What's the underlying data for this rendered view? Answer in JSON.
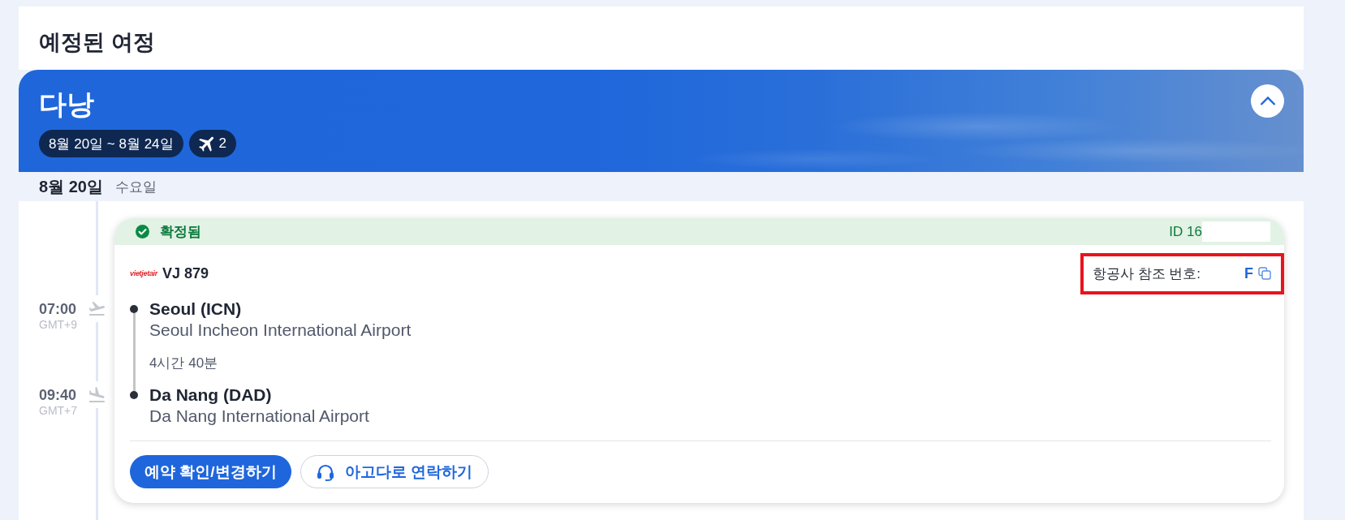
{
  "page": {
    "title": "예정된 여정"
  },
  "trip": {
    "destination": "다낭",
    "date_range": "8월 20일 ~ 8월 24일",
    "flight_count": "2",
    "expanded": true
  },
  "days": [
    {
      "date": "8월 20일",
      "weekday": "수요일",
      "bookings": [
        {
          "status": {
            "kind": "confirmed",
            "label": "확정됨"
          },
          "booking_id": "ID 16",
          "id_redacted": true,
          "airline_logo": "vietjetair",
          "flight_number": "VJ 879",
          "airline_reference": {
            "label": "항공사 참조 번호:",
            "value": "F",
            "highlighted": true
          },
          "stops": [
            {
              "kind": "departure",
              "time": "07:00",
              "timezone": "GMT+9",
              "city": "Seoul (ICN)",
              "airport": "Seoul Incheon International Airport"
            },
            {
              "kind": "arrival",
              "time": "09:40",
              "timezone": "GMT+7",
              "city": "Da Nang (DAD)",
              "airport": "Da Nang International Airport"
            }
          ],
          "duration": "4시간 40분",
          "actions": [
            {
              "kind": "primary",
              "label": "예약 확인/변경하기"
            },
            {
              "kind": "secondary",
              "label": "아고다로 연락하기"
            }
          ]
        }
      ]
    }
  ]
}
